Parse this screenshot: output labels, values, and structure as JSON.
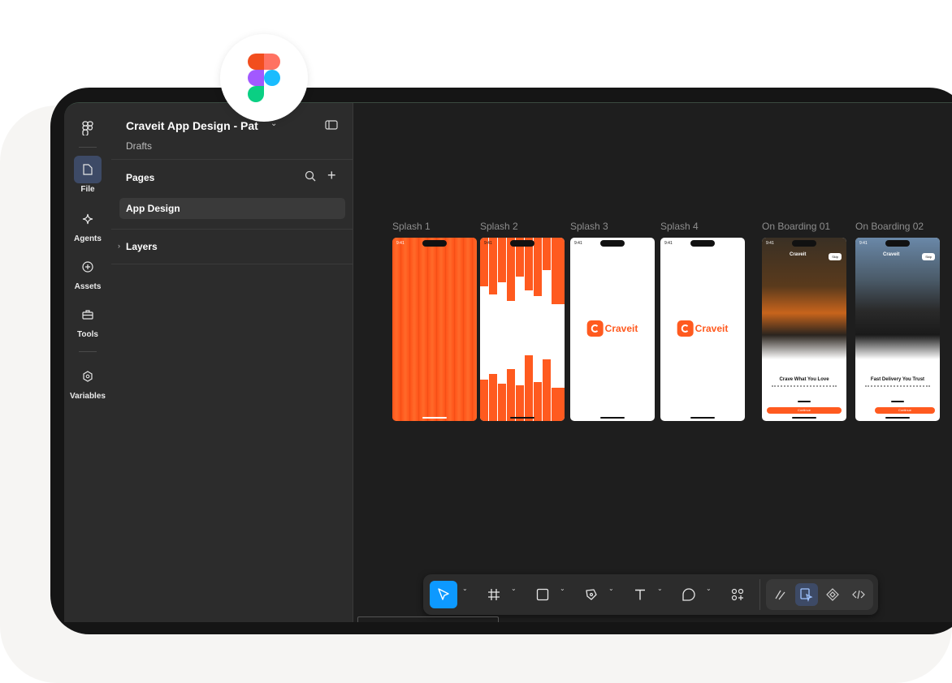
{
  "file": {
    "title": "Craveit App Design - Pat",
    "location": "Drafts"
  },
  "rail": {
    "items": [
      {
        "label": "File",
        "icon": "file-icon"
      },
      {
        "label": "Agents",
        "icon": "sparkle-icon"
      },
      {
        "label": "Assets",
        "icon": "plus-circle-icon"
      },
      {
        "label": "Tools",
        "icon": "toolbox-icon"
      },
      {
        "label": "Variables",
        "icon": "hexagon-icon"
      }
    ]
  },
  "pages": {
    "header": "Pages",
    "items": [
      "App Design"
    ]
  },
  "layers": {
    "header": "Layers"
  },
  "frames": [
    {
      "label": "Splash 1",
      "time": "9:41"
    },
    {
      "label": "Splash 2",
      "time": "9:41"
    },
    {
      "label": "Splash 3",
      "time": "9:41",
      "brand": "Craveit"
    },
    {
      "label": "Splash 4",
      "time": "9:41",
      "brand": "Craveit"
    },
    {
      "label": "On Boarding 01",
      "time": "9:41",
      "heading": "Crave What You Love",
      "skip": "Skip",
      "cta": "Continue",
      "brand": "Craveit"
    },
    {
      "label": "On Boarding 02",
      "time": "9:41",
      "heading": "Fast Delivery You Trust",
      "skip": "Skip",
      "cta": "Continue",
      "brand": "Craveit"
    }
  ],
  "toolbar": {
    "tools": [
      "move-tool",
      "frame-tool",
      "rectangle-tool",
      "pen-tool",
      "text-tool",
      "comment-tool",
      "actions-tool"
    ],
    "modes": [
      "draw-mode",
      "design-mode",
      "prototype-mode",
      "dev-mode"
    ]
  },
  "colors": {
    "brand": "#ff5a1f",
    "accent": "#0d99ff",
    "canvas": "#1e1e1e",
    "panel": "#2c2c2c"
  }
}
